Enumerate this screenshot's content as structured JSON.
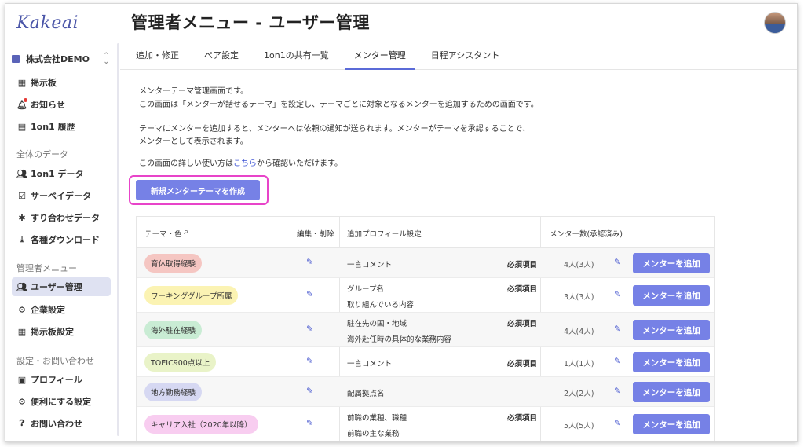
{
  "app": {
    "logo": "Kakeai"
  },
  "sidebar": {
    "company": "株式会社DEMO",
    "items_top": [
      {
        "label": "掲示板",
        "icon": "board-icon"
      },
      {
        "label": "お知らせ",
        "icon": "bell-icon"
      },
      {
        "label": "1on1 履歴",
        "icon": "history-icon"
      }
    ],
    "section_data": "全体のデータ",
    "items_data": [
      {
        "label": "1on1 データ",
        "icon": "people-icon"
      },
      {
        "label": "サーベイデータ",
        "icon": "survey-icon"
      },
      {
        "label": "すり合わせデータ",
        "icon": "puzzle-icon"
      },
      {
        "label": "各種ダウンロード",
        "icon": "download-icon"
      }
    ],
    "section_admin": "管理者メニュー",
    "items_admin": [
      {
        "label": "ユーザー管理",
        "icon": "users-icon"
      },
      {
        "label": "企業設定",
        "icon": "company-icon"
      },
      {
        "label": "掲示板設定",
        "icon": "board-settings-icon"
      }
    ],
    "section_settings": "設定・お問い合わせ",
    "items_settings": [
      {
        "label": "プロフィール",
        "icon": "profile-icon"
      },
      {
        "label": "便利にする設定",
        "icon": "gear-icon"
      },
      {
        "label": "お問い合わせ",
        "icon": "help-icon"
      }
    ]
  },
  "header": {
    "title": "管理者メニュー - ユーザー管理"
  },
  "tabs": [
    "追加・修正",
    "ペア設定",
    "1on1の共有一覧",
    "メンター管理",
    "日程アシスタント"
  ],
  "content": {
    "line1": "メンターテーマ管理画面です。",
    "line2": "この画面は「メンターが話せるテーマ」を設定し、テーマごとに対象となるメンターを追加するための画面です。",
    "line3": "テーマにメンターを追加すると、メンターへは依頼の通知が送られます。メンターがテーマを承認することで、",
    "line4": "メンターとして表示されます。",
    "line5_pre": "この画面の詳しい使い方は",
    "line5_link": "こちら",
    "line5_post": "から確認いただけます。",
    "create_button": "新規メンターテーマを作成"
  },
  "table": {
    "headers": {
      "theme": "テーマ・色",
      "edit": "編集・削除",
      "profile": "追加プロフィール設定",
      "count": "メンター数(承認済み)"
    },
    "add_button": "メンターを追加",
    "rows": [
      {
        "theme": "育休取得経験",
        "color": "#f5c6c2",
        "profile1": "一言コメント",
        "req1": "必須項目",
        "profile2": "",
        "count": "4人(3人)"
      },
      {
        "theme": "ワーキンググループ所属",
        "color": "#fbf3b3",
        "profile1": "グループ名",
        "req1": "必須項目",
        "profile2": "取り組んでいる内容",
        "count": "3人(3人)"
      },
      {
        "theme": "海外駐在経験",
        "color": "#c9ecd4",
        "profile1": "駐在先の国・地域",
        "req1": "必須項目",
        "profile2": "海外赴任時の具体的な業務内容",
        "count": "4人(4人)"
      },
      {
        "theme": "TOEIC900点以上",
        "color": "#e9f3c8",
        "profile1": "一言コメント",
        "req1": "必須項目",
        "profile2": "",
        "count": "1人(1人)"
      },
      {
        "theme": "地方勤務経験",
        "color": "#d6d8f2",
        "profile1": "配属拠点名",
        "req1": "",
        "profile2": "",
        "count": "2人(2人)"
      },
      {
        "theme": "キャリア入社（2020年以降）",
        "color": "#f8cdf0",
        "profile1": "前職の業種、職種",
        "req1": "必須項目",
        "profile2": "前職の主な業務",
        "count": "5人(5人)"
      }
    ]
  }
}
